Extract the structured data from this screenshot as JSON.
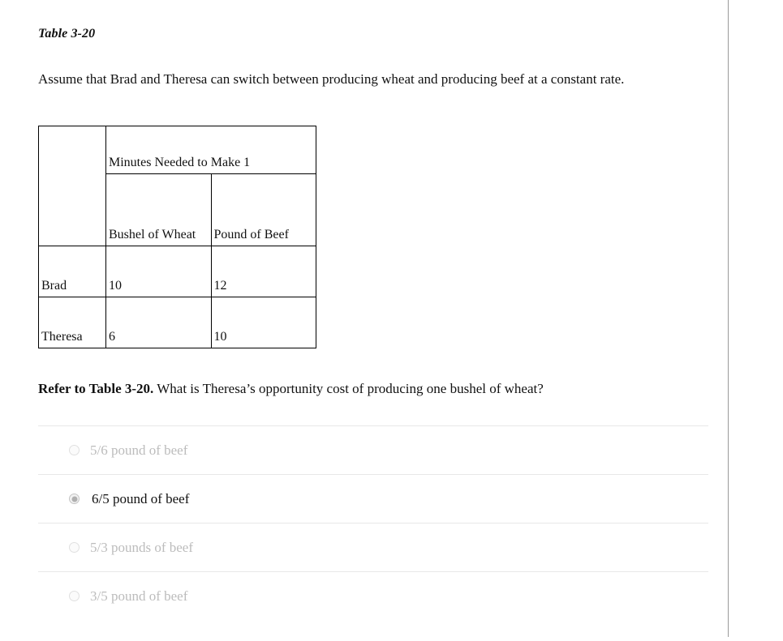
{
  "page": {
    "table_caption": "Table 3-20",
    "intro_text": "Assume that Brad and Theresa can switch between producing wheat and producing beef at a constant rate."
  },
  "data_table": {
    "span_header": "Minutes Needed to Make 1",
    "column_headers": [
      "",
      "Bushel of Wheat",
      "Pound of Beef"
    ],
    "rows": [
      {
        "name": "Brad",
        "wheat": "10",
        "beef": "12"
      },
      {
        "name": "Theresa",
        "wheat": "6",
        "beef": "10"
      }
    ]
  },
  "question": {
    "lead": "Refer to Table 3-20.",
    "text": " What is Theresa’s opportunity cost of producing one bushel of wheat?"
  },
  "options": [
    {
      "label": "5/6 pound of beef",
      "selected": false
    },
    {
      "label": "6/5 pound of beef",
      "selected": true
    },
    {
      "label": "5/3 pounds of beef",
      "selected": false
    },
    {
      "label": "3/5 pound of beef",
      "selected": false
    }
  ],
  "colors": {
    "text": "#111111",
    "muted_text": "#bcbcbc",
    "separator": "#e8e8e8",
    "panel_divider": "#9a9a9a",
    "table_border": "#000000",
    "background": "#ffffff"
  }
}
